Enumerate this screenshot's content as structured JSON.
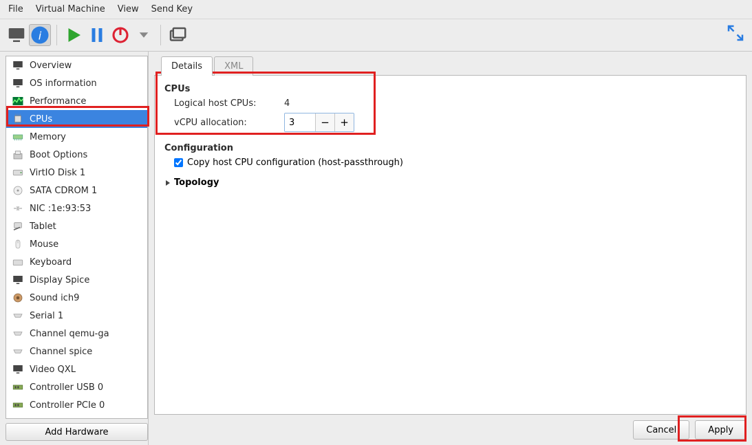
{
  "menu": {
    "file": "File",
    "vm": "Virtual Machine",
    "view": "View",
    "sendkey": "Send Key"
  },
  "sidebar": {
    "items": [
      "Overview",
      "OS information",
      "Performance",
      "CPUs",
      "Memory",
      "Boot Options",
      "VirtIO Disk 1",
      "SATA CDROM 1",
      "NIC :1e:93:53",
      "Tablet",
      "Mouse",
      "Keyboard",
      "Display Spice",
      "Sound ich9",
      "Serial 1",
      "Channel qemu-ga",
      "Channel spice",
      "Video QXL",
      "Controller USB 0",
      "Controller PCIe 0"
    ],
    "selected": "CPUs",
    "add_hw": "Add Hardware"
  },
  "tabs": {
    "details": "Details",
    "xml": "XML"
  },
  "cpus": {
    "section": "CPUs",
    "logical_label": "Logical host CPUs:",
    "logical_value": "4",
    "vcpu_label": "vCPU allocation:",
    "vcpu_value": "3"
  },
  "config": {
    "section": "Configuration",
    "copy_label": "Copy host CPU configuration (host-passthrough)"
  },
  "topology": {
    "section": "Topology"
  },
  "footer": {
    "cancel": "Cancel",
    "apply": "Apply"
  }
}
